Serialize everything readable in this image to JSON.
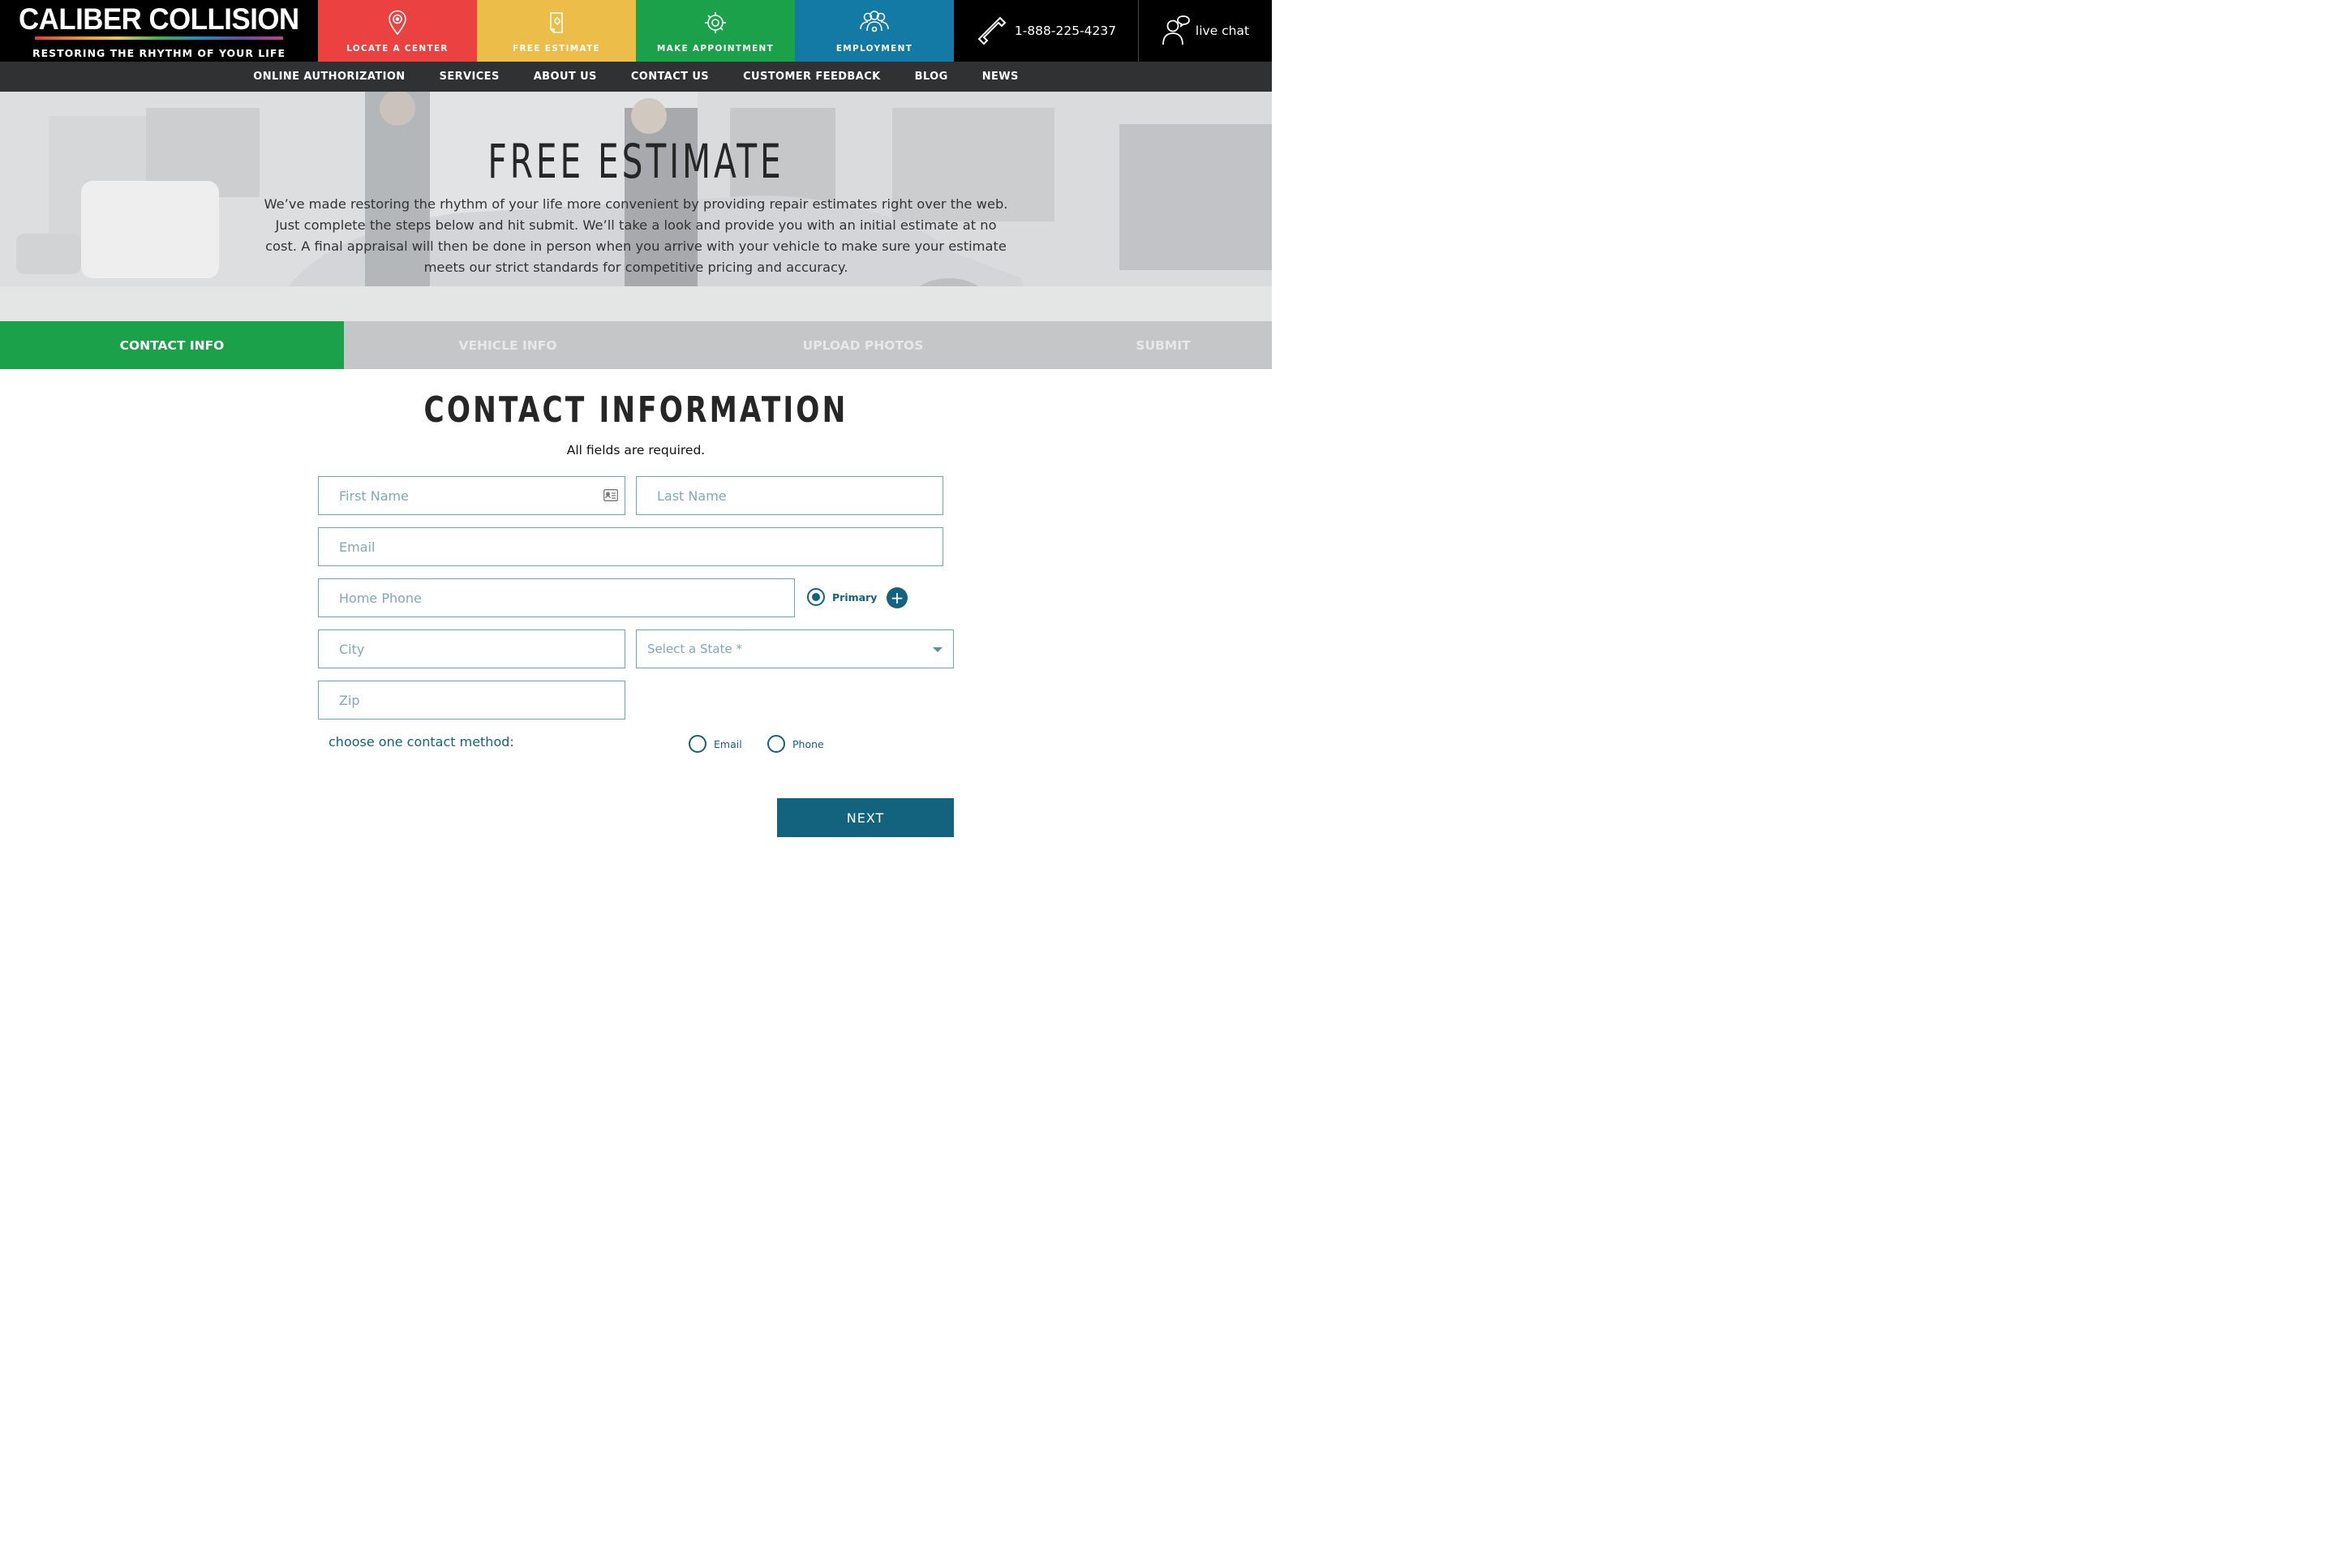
{
  "brand": {
    "name": "CALIBER COLLISION",
    "tagline": "RESTORING THE RHYTHM OF YOUR LIFE"
  },
  "header_tiles": [
    {
      "label": "LOCATE A CENTER",
      "icon": "location-pin-icon",
      "color": "#ec4141"
    },
    {
      "label": "FREE ESTIMATE",
      "icon": "estimate-document-icon",
      "color": "#edbd49"
    },
    {
      "label": "MAKE APPOINTMENT",
      "icon": "appointment-gear-icon",
      "color": "#1ba149"
    },
    {
      "label": "EMPLOYMENT",
      "icon": "people-group-icon",
      "color": "#137aa5"
    }
  ],
  "contact": {
    "phone": "1-888-225-4237",
    "chat": "live chat"
  },
  "nav": {
    "items": [
      "ONLINE AUTHORIZATION",
      "SERVICES",
      "ABOUT US",
      "CONTACT US",
      "CUSTOMER FEEDBACK",
      "BLOG",
      "NEWS"
    ]
  },
  "hero": {
    "title": "FREE ESTIMATE",
    "text": "We’ve made restoring the rhythm of your life more convenient by providing repair estimates right over the web. Just complete the steps below and hit submit. We’ll take a look and provide you with an initial estimate at no cost. A final appraisal will then be done in person when you arrive with your vehicle to make sure your estimate meets our strict standards for competitive pricing and accuracy."
  },
  "steps": [
    {
      "label": "CONTACT INFO",
      "active": true
    },
    {
      "label": "VEHICLE INFO",
      "active": false
    },
    {
      "label": "UPLOAD PHOTOS",
      "active": false
    },
    {
      "label": "SUBMIT",
      "active": false
    }
  ],
  "form": {
    "title": "CONTACT INFORMATION",
    "subtitle": "All fields are required.",
    "first_name_placeholder": "First Name",
    "last_name_placeholder": "Last Name",
    "email_placeholder": "Email",
    "home_phone_placeholder": "Home Phone",
    "primary_label": "Primary",
    "add_phone_symbol": "+",
    "city_placeholder": "City",
    "state_selected": "Select a State *",
    "zip_placeholder": "Zip",
    "contact_method_label": "choose one contact method:",
    "contact_options": [
      "Email",
      "Phone"
    ],
    "next_label": "NEXT"
  },
  "colors": {
    "accent_green": "#1aa14a",
    "accent_teal": "#13627e",
    "field_border": "#6fa5b7"
  }
}
